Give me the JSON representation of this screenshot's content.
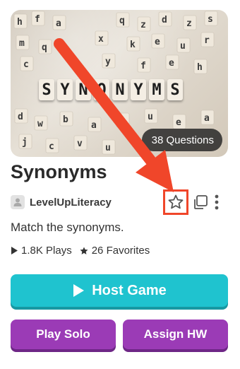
{
  "set": {
    "title": "Synonyms",
    "questions_badge": "38 Questions",
    "author": "LevelUpLiteracy",
    "description": "Match the synonyms.",
    "plays": "1.8K Plays",
    "favorites": "26 Favorites",
    "cover_word": [
      "S",
      "Y",
      "N",
      "O",
      "N",
      "Y",
      "M",
      "S"
    ]
  },
  "actions": {
    "host_label": "Host Game",
    "solo_label": "Play Solo",
    "hw_label": "Assign HW"
  },
  "icons": {
    "favorite": "star-outline-icon",
    "copy": "copy-icon",
    "more": "more-vertical-icon",
    "play": "play-icon",
    "heart": "star-icon"
  },
  "colors": {
    "host": "#1fc3cf",
    "purple": "#9b3bb6",
    "annotation": "#f0462a"
  }
}
